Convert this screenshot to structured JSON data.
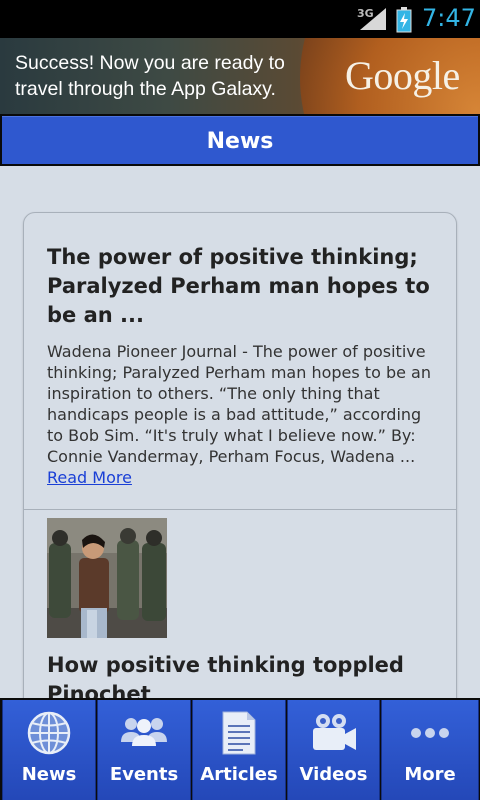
{
  "status_bar": {
    "network": "3G",
    "clock": "7:47",
    "clock_color": "#33b5e5",
    "icons": [
      "signal-icon",
      "battery-icon"
    ]
  },
  "ad": {
    "text": "Success! Now you are ready to travel through the App Galaxy.",
    "logo": "Google"
  },
  "header": {
    "title": "News",
    "color": "#2f58cf"
  },
  "articles": [
    {
      "headline": "The power of positive thinking; Paralyzed Perham man hopes to be an ...",
      "summary": "Wadena Pioneer Journal - The power of positive thinking; Paralyzed Perham man hopes to be an inspiration to others. “The only thing that handicaps people is a bad attitude,” according to Bob Sim. “It's truly what I believe now.” By: Connie Vandermay, Perham Focus, Wadena ...",
      "read_more": "Read More"
    },
    {
      "headline": "How positive thinking toppled Pinochet",
      "image": "article-photo"
    }
  ],
  "tabs": [
    {
      "label": "News",
      "icon": "globe-icon"
    },
    {
      "label": "Events",
      "icon": "people-icon"
    },
    {
      "label": "Articles",
      "icon": "document-icon"
    },
    {
      "label": "Videos",
      "icon": "video-camera-icon"
    },
    {
      "label": "More",
      "icon": "more-dots-icon"
    }
  ]
}
